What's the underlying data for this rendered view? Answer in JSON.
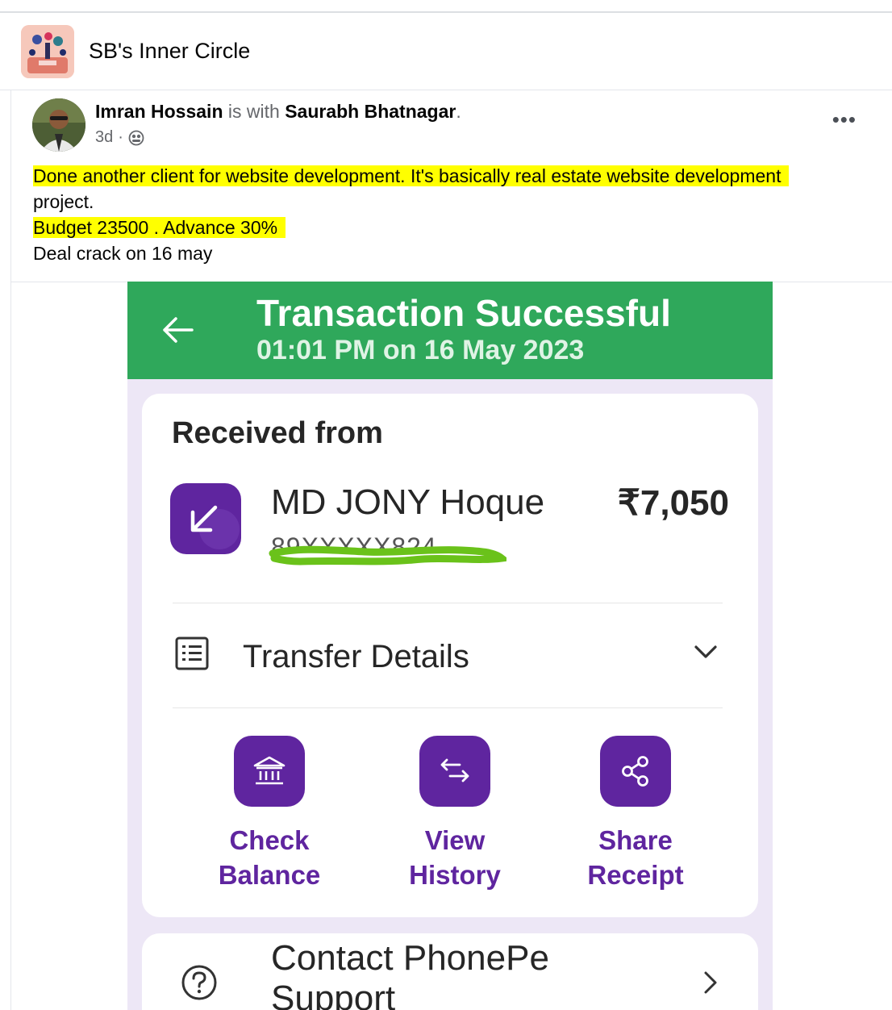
{
  "group": {
    "name": "SB's Inner Circle"
  },
  "post": {
    "author": "Imran Hossain",
    "with_word": "is with",
    "tagged": "Saurabh Bhatnagar",
    "period": ".",
    "time": "3d",
    "dot": "·",
    "audience_icon": "globe-icon",
    "more": "•••",
    "lines": [
      "Done another client for website development. It's basically real estate website development",
      "project.",
      "Budget 23500 . Advance 30%",
      "Deal crack on 16 may"
    ]
  },
  "receipt": {
    "title": "Transaction Successful",
    "datetime": "01:01 PM on 16 May 2023",
    "received_label": "Received from",
    "payer": "MD JONY Hoque",
    "amount": "₹7,050",
    "masked_number": "89XXXXX824",
    "details_label": "Transfer Details",
    "actions": [
      {
        "line1": "Check",
        "line2": "Balance",
        "icon": "bank-icon"
      },
      {
        "line1": "View",
        "line2": "History",
        "icon": "swap-arrows-icon"
      },
      {
        "line1": "Share",
        "line2": "Receipt",
        "icon": "share-icon"
      }
    ],
    "contact_label": "Contact PhonePe Support"
  },
  "colors": {
    "header_green": "#2fa85b",
    "phonepe_purple": "#5f259f",
    "highlight": "#ffff00",
    "scribble_green": "#6ac21a"
  }
}
